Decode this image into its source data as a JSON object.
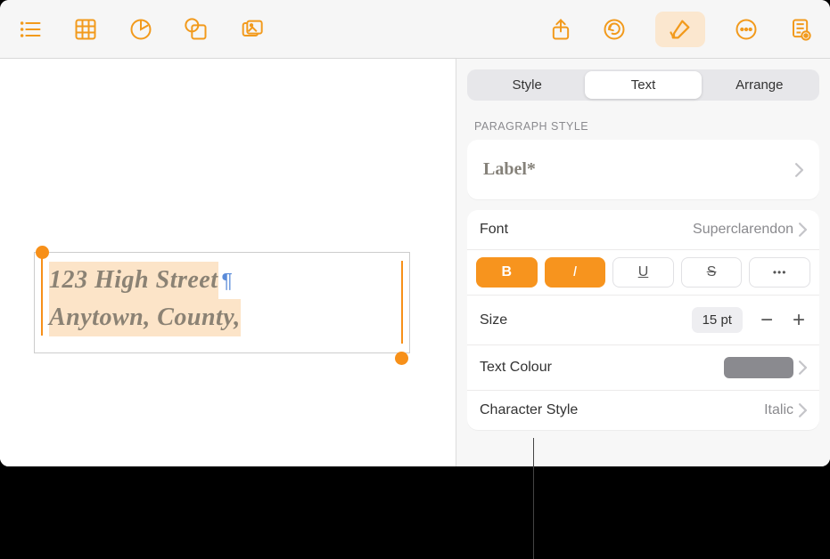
{
  "tabs": {
    "style": "Style",
    "text": "Text",
    "arrange": "Arrange"
  },
  "sections": {
    "paragraphStyle": "PARAGRAPH STYLE"
  },
  "paragraphStyle": {
    "name": "Label*"
  },
  "font": {
    "label": "Font",
    "value": "Superclarendon"
  },
  "format": {
    "bold": "B",
    "italic": "I",
    "underline": "U",
    "strike": "S",
    "more": "•••"
  },
  "size": {
    "label": "Size",
    "value": "15 pt",
    "minus": "−",
    "plus": "+"
  },
  "textColour": {
    "label": "Text Colour",
    "hex": "#8a8a8f"
  },
  "characterStyle": {
    "label": "Character Style",
    "value": "Italic"
  },
  "canvas": {
    "line1": "123 High Street",
    "line2": "Anytown, County,"
  }
}
